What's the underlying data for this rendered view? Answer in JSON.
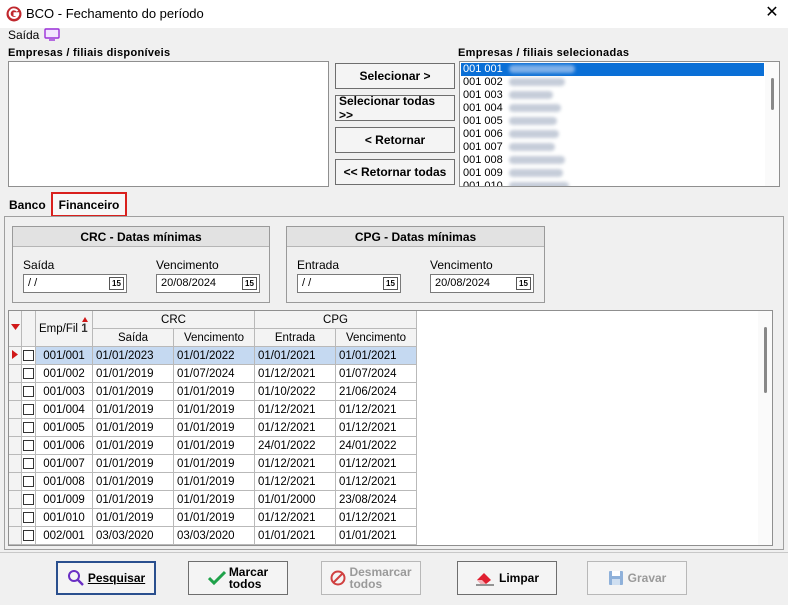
{
  "window": {
    "title": "BCO - Fechamento do período",
    "close": "✕"
  },
  "menu": {
    "saida": "Saída"
  },
  "available": {
    "label": "Empresas / filiais disponíveis"
  },
  "selected": {
    "label": "Empresas / filiais selecionadas",
    "items": [
      "001 001",
      "001 002",
      "001 003",
      "001 004",
      "001 005",
      "001 006",
      "001 007",
      "001 008",
      "001 009",
      "001 010"
    ]
  },
  "buttons": {
    "selecionar": "Selecionar >",
    "selecionar_todas": "Selecionar todas >>",
    "retornar": "< Retornar",
    "retornar_todas": "<< Retornar todas"
  },
  "tabs": {
    "banco": "Banco",
    "financeiro": "Financeiro"
  },
  "crc_group": {
    "title": "CRC - Datas mínimas",
    "saida_label": "Saída",
    "saida_value": " / /",
    "venc_label": "Vencimento",
    "venc_value": "20/08/2024"
  },
  "cpg_group": {
    "title": "CPG - Datas mínimas",
    "entrada_label": "Entrada",
    "entrada_value": " / /",
    "venc_label": "Vencimento",
    "venc_value": "20/08/2024"
  },
  "cal_icon": "15",
  "grid": {
    "col_emp": "Emp/Fil",
    "sort_num": "1",
    "crc": "CRC",
    "cpg": "CPG",
    "saida": "Saída",
    "vencimento": "Vencimento",
    "entrada": "Entrada",
    "vencimento2": "Vencimento",
    "rows": [
      [
        "001/001",
        "01/01/2023",
        "01/01/2022",
        "01/01/2021",
        "01/01/2021"
      ],
      [
        "001/002",
        "01/01/2019",
        "01/07/2024",
        "01/12/2021",
        "01/07/2024"
      ],
      [
        "001/003",
        "01/01/2019",
        "01/01/2019",
        "01/10/2022",
        "21/06/2024"
      ],
      [
        "001/004",
        "01/01/2019",
        "01/01/2019",
        "01/12/2021",
        "01/12/2021"
      ],
      [
        "001/005",
        "01/01/2019",
        "01/01/2019",
        "01/12/2021",
        "01/12/2021"
      ],
      [
        "001/006",
        "01/01/2019",
        "01/01/2019",
        "24/01/2022",
        "24/01/2022"
      ],
      [
        "001/007",
        "01/01/2019",
        "01/01/2019",
        "01/12/2021",
        "01/12/2021"
      ],
      [
        "001/008",
        "01/01/2019",
        "01/01/2019",
        "01/12/2021",
        "01/12/2021"
      ],
      [
        "001/009",
        "01/01/2019",
        "01/01/2019",
        "01/01/2000",
        "23/08/2024"
      ],
      [
        "001/010",
        "01/01/2019",
        "01/01/2019",
        "01/12/2021",
        "01/12/2021"
      ],
      [
        "002/001",
        "03/03/2020",
        "03/03/2020",
        "01/01/2021",
        "01/01/2021"
      ]
    ]
  },
  "bottom": {
    "pesquisar": "Pesquisar",
    "marcar_l1": "Marcar",
    "marcar_l2": "todos",
    "desmarcar_l1": "Desmarcar",
    "desmarcar_l2": "todos",
    "limpar": "Limpar",
    "gravar": "Gravar"
  },
  "colors": {
    "accent": "#0a6fd6",
    "highlight_border": "#d9201d",
    "logo": "#c0272d"
  }
}
